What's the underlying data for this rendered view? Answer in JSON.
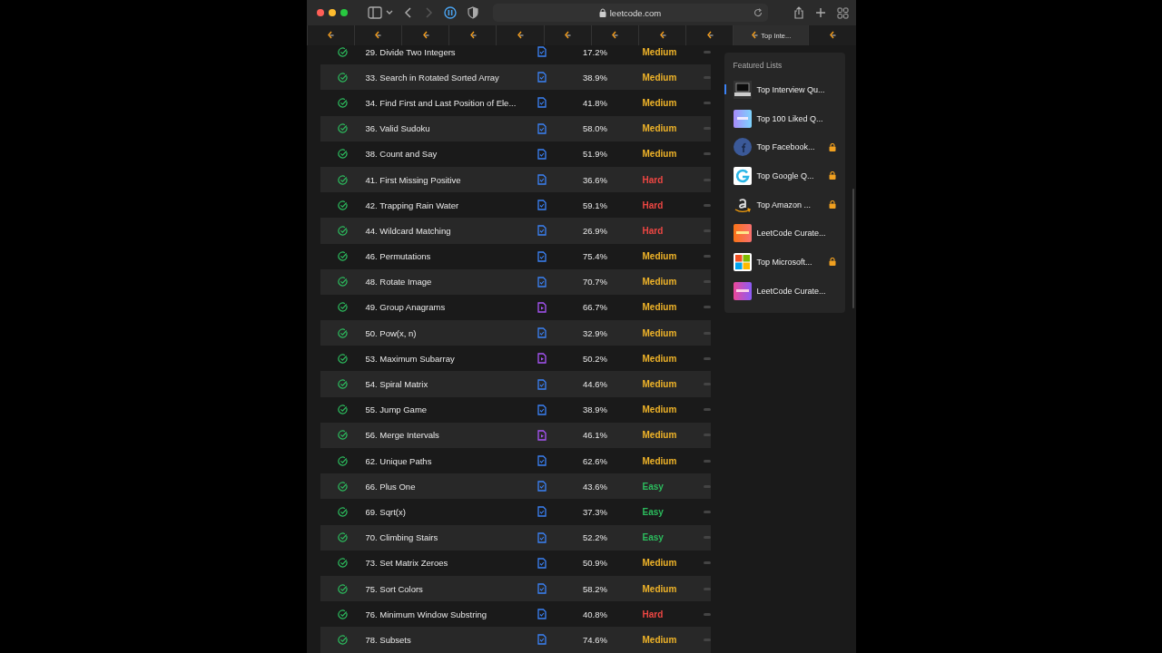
{
  "browser": {
    "address": "leetcode.com",
    "tabs": [
      {
        "selected": false
      },
      {
        "selected": false
      },
      {
        "selected": false
      },
      {
        "selected": false
      },
      {
        "selected": false
      },
      {
        "selected": false
      },
      {
        "selected": false
      },
      {
        "selected": false
      },
      {
        "selected": false
      },
      {
        "label": "Top Inte...",
        "selected": true
      },
      {
        "selected": false
      }
    ]
  },
  "problems": [
    {
      "title": "29. Divide Two Integers",
      "solved": true,
      "kind": "article",
      "acceptance": "17.2%",
      "difficulty": "Medium",
      "color": "#f0b429"
    },
    {
      "title": "33. Search in Rotated Sorted Array",
      "solved": true,
      "kind": "article",
      "acceptance": "38.9%",
      "difficulty": "Medium",
      "color": "#f0b429"
    },
    {
      "title": "34. Find First and Last Position of Ele...",
      "solved": true,
      "kind": "article",
      "acceptance": "41.8%",
      "difficulty": "Medium",
      "color": "#f0b429"
    },
    {
      "title": "36. Valid Sudoku",
      "solved": true,
      "kind": "article",
      "acceptance": "58.0%",
      "difficulty": "Medium",
      "color": "#f0b429"
    },
    {
      "title": "38. Count and Say",
      "solved": true,
      "kind": "article",
      "acceptance": "51.9%",
      "difficulty": "Medium",
      "color": "#f0b429"
    },
    {
      "title": "41. First Missing Positive",
      "solved": true,
      "kind": "article",
      "acceptance": "36.6%",
      "difficulty": "Hard",
      "color": "#ef4743"
    },
    {
      "title": "42. Trapping Rain Water",
      "solved": true,
      "kind": "article",
      "acceptance": "59.1%",
      "difficulty": "Hard",
      "color": "#ef4743"
    },
    {
      "title": "44. Wildcard Matching",
      "solved": true,
      "kind": "article",
      "acceptance": "26.9%",
      "difficulty": "Hard",
      "color": "#ef4743"
    },
    {
      "title": "46. Permutations",
      "solved": true,
      "kind": "article",
      "acceptance": "75.4%",
      "difficulty": "Medium",
      "color": "#f0b429"
    },
    {
      "title": "48. Rotate Image",
      "solved": true,
      "kind": "article",
      "acceptance": "70.7%",
      "difficulty": "Medium",
      "color": "#f0b429"
    },
    {
      "title": "49. Group Anagrams",
      "solved": true,
      "kind": "video",
      "acceptance": "66.7%",
      "difficulty": "Medium",
      "color": "#f0b429"
    },
    {
      "title": "50. Pow(x, n)",
      "solved": true,
      "kind": "article",
      "acceptance": "32.9%",
      "difficulty": "Medium",
      "color": "#f0b429"
    },
    {
      "title": "53. Maximum Subarray",
      "solved": true,
      "kind": "video",
      "acceptance": "50.2%",
      "difficulty": "Medium",
      "color": "#f0b429"
    },
    {
      "title": "54. Spiral Matrix",
      "solved": true,
      "kind": "article",
      "acceptance": "44.6%",
      "difficulty": "Medium",
      "color": "#f0b429"
    },
    {
      "title": "55. Jump Game",
      "solved": true,
      "kind": "article",
      "acceptance": "38.9%",
      "difficulty": "Medium",
      "color": "#f0b429"
    },
    {
      "title": "56. Merge Intervals",
      "solved": true,
      "kind": "video",
      "acceptance": "46.1%",
      "difficulty": "Medium",
      "color": "#f0b429"
    },
    {
      "title": "62. Unique Paths",
      "solved": true,
      "kind": "article",
      "acceptance": "62.6%",
      "difficulty": "Medium",
      "color": "#f0b429"
    },
    {
      "title": "66. Plus One",
      "solved": true,
      "kind": "article",
      "acceptance": "43.6%",
      "difficulty": "Easy",
      "color": "#2cbb5d"
    },
    {
      "title": "69. Sqrt(x)",
      "solved": true,
      "kind": "article",
      "acceptance": "37.3%",
      "difficulty": "Easy",
      "color": "#2cbb5d"
    },
    {
      "title": "70. Climbing Stairs",
      "solved": true,
      "kind": "article",
      "acceptance": "52.2%",
      "difficulty": "Easy",
      "color": "#2cbb5d"
    },
    {
      "title": "73. Set Matrix Zeroes",
      "solved": true,
      "kind": "article",
      "acceptance": "50.9%",
      "difficulty": "Medium",
      "color": "#f0b429"
    },
    {
      "title": "75. Sort Colors",
      "solved": true,
      "kind": "article",
      "acceptance": "58.2%",
      "difficulty": "Medium",
      "color": "#f0b429"
    },
    {
      "title": "76. Minimum Window Substring",
      "solved": true,
      "kind": "article",
      "acceptance": "40.8%",
      "difficulty": "Hard",
      "color": "#ef4743"
    },
    {
      "title": "78. Subsets",
      "solved": true,
      "kind": "article",
      "acceptance": "74.6%",
      "difficulty": "Medium",
      "color": "#f0b429"
    }
  ],
  "featured_lists": {
    "title": "Featured Lists",
    "items": [
      {
        "label": "Top Interview Qu...",
        "kind": "laptop",
        "locked": false,
        "selected": true
      },
      {
        "label": "Top 100 Liked Q...",
        "kind": "top",
        "locked": false,
        "selected": false
      },
      {
        "label": "Top Facebook...",
        "kind": "facebook",
        "locked": true,
        "selected": false
      },
      {
        "label": "Top Google Q...",
        "kind": "google",
        "locked": true,
        "selected": false
      },
      {
        "label": "Top Amazon ...",
        "kind": "amazon",
        "locked": true,
        "selected": false
      },
      {
        "label": "LeetCode Curate...",
        "kind": "hot",
        "locked": false,
        "selected": false
      },
      {
        "label": "Top Microsoft...",
        "kind": "microsoft",
        "locked": true,
        "selected": false
      },
      {
        "label": "LeetCode Curate...",
        "kind": "sql",
        "locked": false,
        "selected": false
      }
    ]
  }
}
